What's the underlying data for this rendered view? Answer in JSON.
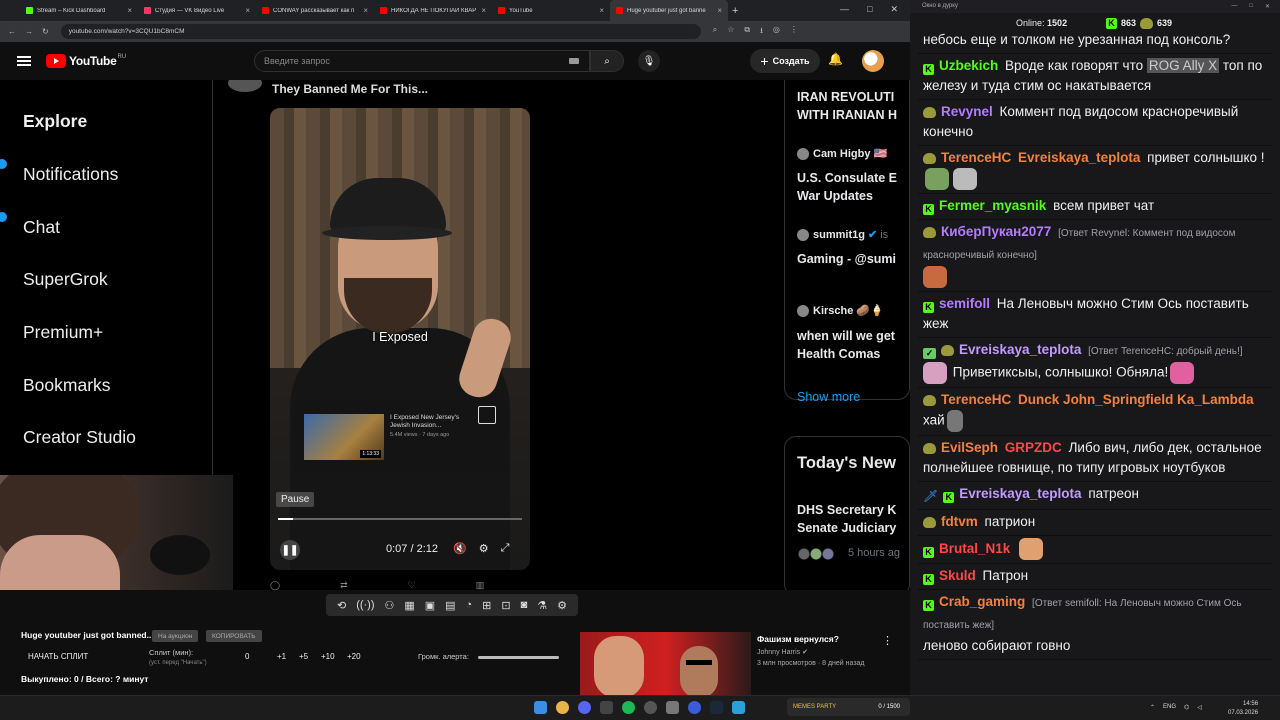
{
  "browser": {
    "tabs": [
      {
        "label": "Stream – Kick Dashboard",
        "color": "#53fc18"
      },
      {
        "label": "Студия — VK Видео Live",
        "color": "#ff3366"
      },
      {
        "label": "CONWAY рассказывает как п",
        "color": "#ff0000"
      },
      {
        "label": "НИКОГДА НЕ ПОКУПАЙ КВАР",
        "color": "#ff0000"
      },
      {
        "label": "YouTube",
        "color": "#ff0000"
      },
      {
        "label": "Huge youtuber just got banne",
        "color": "#ff0000"
      }
    ],
    "url": "youtube.com/watch?v=3CQU1bC8mCM"
  },
  "youtube": {
    "logo_text": "YouTube",
    "region": "RU",
    "search_placeholder": "Введите запрос",
    "create_label": "Создать"
  },
  "video": {
    "x_sidebar": [
      "Explore",
      "Notifications",
      "Chat",
      "SuperGrok",
      "Premium+",
      "Bookmarks",
      "Creator Studio"
    ],
    "feed_title": "They Banned Me For This...",
    "caption": "I Exposed",
    "rec_title": "I Exposed New Jersey's Jewish Invasion...",
    "rec_meta": "5.4M views · 7 days ago",
    "rec_duration": "1:13:33",
    "pause_tooltip": "Pause",
    "time": "0:07 / 2:12",
    "progress": 0.06,
    "x_right": {
      "headline1": "IRAN REVOLUTI",
      "headline1b": "WITH IRANIAN H",
      "user1": "Cam Higby",
      "text1a": "U.S. Consulate E",
      "text1b": "War Updates",
      "user2": "summit1g",
      "user2b": "is",
      "text2": "Gaming - @sumi",
      "user3": "Kirsche",
      "text3a": "when will we get",
      "text3b": "Health Comas",
      "show_more": "Show more",
      "today_news": "Today's New",
      "news1a": "DHS Secretary K",
      "news1b": "Senate Judiciary",
      "hours_ago": "5 hours ag"
    }
  },
  "bottom": {
    "title": "Huge youtuber just got banned..",
    "pill1": "На аукцион",
    "pill2": "КОПИРОВАТЬ",
    "split_btn": "НАЧАТЬ СПЛИТ",
    "split_min_label": "Сплит (мин):",
    "split_min_sub": "(уст. перед \"Начать\")",
    "split_value": "0",
    "add_buttons": [
      "+1",
      "+5",
      "+10",
      "+20"
    ],
    "alert_label": "Громк. алерта:",
    "alert_volume": 0.9,
    "bought": "Выкуплено: 0 / Всего: ? минут",
    "video_title": "Фашизм вернулся?",
    "video_channel": "Johnny Harris",
    "video_meta": "3 млн просмотров · 8 дней назад"
  },
  "chat": {
    "window_title": "Окно в дурку",
    "online_label": "Online:",
    "online_count": "1502",
    "kick_count": "863",
    "pepe_count": "639",
    "messages": [
      {
        "text": "небось еще и толком не урезанная под консоль?"
      },
      {
        "name": "Uzbekich",
        "text_before": "Вроде как говорят что ",
        "highlight": "ROG Ally X",
        "text_after": " топ по железу и туда стим ос накатывается"
      },
      {
        "name": "Revynel",
        "text": "Коммент под видосом красноречивый конечно"
      },
      {
        "name": "TerenceHC",
        "mention": "Evreiskaya_teplota",
        "text": "привет солнышко !"
      },
      {
        "name": "Fermer_myasnik",
        "text": "всем привет чат"
      },
      {
        "name": "КиберПукан2077",
        "reply": "[Ответ Revynel: Коммент под видосом красноречивый конечно]"
      },
      {
        "name": "semifoll",
        "text": "На Леновыч можно Стим Ось поставить жеж"
      },
      {
        "name": "Evreiskaya_teplota",
        "reply": "[Ответ TerenceHC: добрый день!]",
        "text": "Приветиксыы, солнышко! Обняла!"
      },
      {
        "name": "TerenceHC",
        "mention": "Dunck John_Springfield Ka_Lambda",
        "text": "хай"
      },
      {
        "name": "EvilSeph",
        "mention": "GRPZDC",
        "text": "Либо вич, либо дек, остальное полнейшее говнище, по типу игровых ноутбуков"
      },
      {
        "name": "Evreiskaya_teplota",
        "text": "патреон"
      },
      {
        "name": "fdtvm",
        "text": "патрион"
      },
      {
        "name": "Brutal_N1k",
        "text": ""
      },
      {
        "name": "Skuld",
        "text": "Патрон"
      },
      {
        "name": "Crab_gaming",
        "reply": "[Ответ semifoll: На Леновыч можно Стим Ось поставить жеж]",
        "text": "леново собирают говно"
      }
    ]
  },
  "taskbar": {
    "memes_label": "MEMES PARTY",
    "memes_count": "0 / 1500",
    "lang": "ENG",
    "time": "14:56",
    "date": "07.03.2026"
  }
}
